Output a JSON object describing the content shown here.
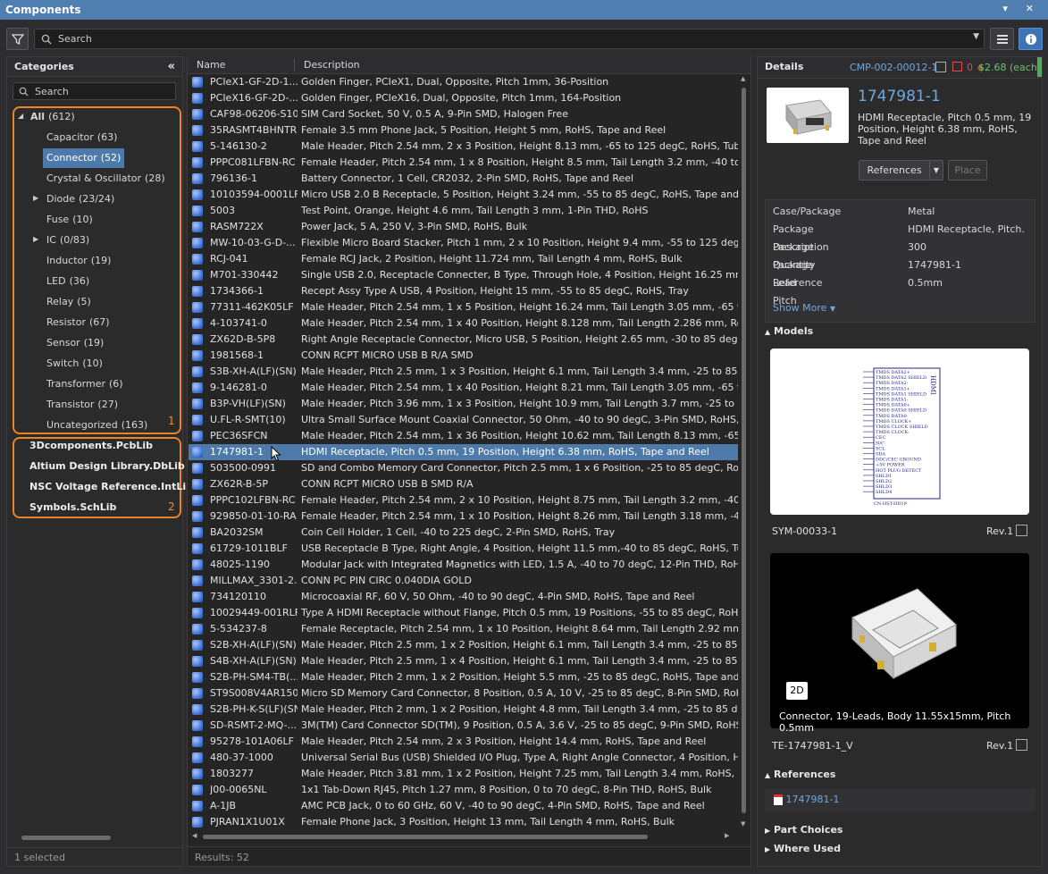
{
  "window": {
    "title": "Components"
  },
  "toolbar": {
    "search_placeholder": "Search"
  },
  "categories": {
    "header": "Categories",
    "search_placeholder": "Search",
    "items": [
      {
        "label": "All",
        "count": "(612)"
      },
      {
        "label": "Capacitor",
        "count": "(63)"
      },
      {
        "label": "Connector",
        "count": "(52)"
      },
      {
        "label": "Crystal & Oscillator",
        "count": "(28)"
      },
      {
        "label": "Diode",
        "count": "(23/24)"
      },
      {
        "label": "Fuse",
        "count": "(10)"
      },
      {
        "label": "IC",
        "count": "(0/83)"
      },
      {
        "label": "Inductor",
        "count": "(19)"
      },
      {
        "label": "LED",
        "count": "(36)"
      },
      {
        "label": "Relay",
        "count": "(5)"
      },
      {
        "label": "Resistor",
        "count": "(67)"
      },
      {
        "label": "Sensor",
        "count": "(19)"
      },
      {
        "label": "Switch",
        "count": "(10)"
      },
      {
        "label": "Transformer",
        "count": "(6)"
      },
      {
        "label": "Transistor",
        "count": "(27)"
      },
      {
        "label": "Uncategorized",
        "count": "(163)"
      }
    ],
    "libraries": [
      "3Dcomponents.PcbLib",
      "Altium Design Library.DbLib",
      "NSC Voltage Reference.IntLib",
      "Symbols.SchLib"
    ],
    "tag1": "1",
    "tag2": "2",
    "status": "1 selected"
  },
  "grid": {
    "col_name": "Name",
    "col_desc": "Description",
    "status": "Results: 52",
    "rows": [
      [
        "PCIeX1-GF-2D-1...",
        "Golden Finger, PCIeX1, Dual, Opposite, Pitch 1mm, 36-Position"
      ],
      [
        "PCIeX16-GF-2D-...",
        "Golden Finger, PCIeX16, Dual, Opposite, Pitch 1mm, 164-Position"
      ],
      [
        "CAF98-06206-S100",
        "SIM Card Socket, 50 V, 0.5 A, 9-Pin SMD, Halogen Free"
      ],
      [
        "35RASMT4BHNTRX",
        "Female 3.5 mm Phone Jack, 5 Position, Height 5 mm, RoHS, Tape and Reel"
      ],
      [
        "5-146130-2",
        "Male Header, Pitch 2.54 mm, 2 x 3 Position, Height 8.13 mm, -65 to 125 degC, RoHS, Tube"
      ],
      [
        "PPPC081LFBN-RC",
        "Female Header, Pitch 2.54 mm, 1 x 8 Position, Height 8.5 mm, Tail Length 3.2 mm, -40 to 105 degC"
      ],
      [
        "796136-1",
        "Battery Connector, 1 Cell, CR2032, 2-Pin SMD, RoHS, Tape and Reel"
      ],
      [
        "10103594-0001LF",
        "Micro USB 2.0 B Receptacle, 5 Position, Height 3.24 mm, -55 to 85 degC, RoHS, Tape and Reel"
      ],
      [
        "5003",
        "Test Point, Orange, Height 4.6 mm, Tail Length 3 mm, 1-Pin THD, RoHS"
      ],
      [
        "RASM722X",
        "Power Jack, 5 A, 250 V, 3-Pin SMD, RoHS, Bulk"
      ],
      [
        "MW-10-03-G-D-...",
        "Flexible Micro Board Stacker, Pitch 1 mm, 2 x 10 Position, Height 9.4 mm, -55 to 125 degC, RoHS,"
      ],
      [
        "RCJ-041",
        "Female RCJ Jack, 2 Position, Height 11.724 mm, Tail Length 4 mm, RoHS, Bulk"
      ],
      [
        "M701-330442",
        "Single USB 2.0, Receptacle Connecter, B Type, Through Hole, 4 Position, Height 16.25 mm, -55 to"
      ],
      [
        "1734366-1",
        "Recept Assy Type A USB, 4 Position, Height 15 mm, -55 to 85 degC, RoHS, Tray"
      ],
      [
        "77311-462K05LF",
        "Male Header, Pitch 2.54 mm, 1 x 5 Position, Height 16.24 mm, Tail Length 3.05 mm, -65 to 125 deg"
      ],
      [
        "4-103741-0",
        "Male Header, Pitch 2.54 mm, 1 x 40 Position, Height 8.128 mm, Tail Length 2.286 mm, RoHS, Bulk"
      ],
      [
        "ZX62D-B-5P8",
        "Right Angle Receptacle Connector, Micro USB, 5 Position, Height 2.65 mm, -30 to 85 degC, RoHS"
      ],
      [
        "1981568-1",
        "CONN RCPT MICRO USB B R/A SMD"
      ],
      [
        "S3B-XH-A(LF)(SN)",
        "Male Header, Pitch 2.5 mm, 1 x 3 Position, Height 6.1 mm, Tail Length 3.4 mm, -25 to 85 degC, Ro"
      ],
      [
        "9-146281-0",
        "Male Header, Pitch 2.54 mm, 1 x 40 Position, Height 8.21 mm, Tail Length 3.05 mm, -65 to 105 deg"
      ],
      [
        "B3P-VH(LF)(SN)",
        "Male Header, Pitch 3.96 mm, 1 x 3 Position, Height 10.9 mm, Tail Length 3.7 mm, -25 to 85 degC, I"
      ],
      [
        "U.FL-R-SMT(10)",
        "Ultra Small Surface Mount Coaxial Connector, 50 Ohm, -40 to 90 degC, 3-Pin SMD, RoHS, Tape a"
      ],
      [
        "PEC36SFCN",
        "Male Header, Pitch 2.54 mm, 1 x 36 Position, Height 10.62 mm, Tail Length 8.13 mm, -65 to 125 de"
      ],
      [
        "1747981-1",
        "HDMI Receptacle, Pitch 0.5 mm, 19 Position, Height 6.38 mm, RoHS, Tape and Reel"
      ],
      [
        "503500-0991",
        "SD and Combo Memory Card Connector, Pitch 2.5 mm, 1 x 6 Position, -25 to 85 degC, RoHS, Tape"
      ],
      [
        "ZX62R-B-5P",
        "CONN RCPT MICRO USB B SMD R/A"
      ],
      [
        "PPPC102LFBN-RC",
        "Female Header, Pitch 2.54 mm, 2 x 10 Position, Height 8.75 mm, Tail Length 3.2 mm, -40 to 105 de"
      ],
      [
        "929850-01-10-RA",
        "Female Header, Pitch 2.54 mm, 1 x 10 Position, Height 8.26 mm, Tail Length 3.18 mm, -40 to 105 d"
      ],
      [
        "BA2032SM",
        "Coin Cell Holder, 1 Cell, -40 to 225 degC, 2-Pin SMD, RoHS, Tray"
      ],
      [
        "61729-1011BLF",
        "USB Receptacle B Type, Right Angle, 4 Position, Height 11.5 mm,-40 to 85 degC, RoHS, Tube"
      ],
      [
        "48025-1190",
        "Modular Jack with Integrated Magnetics with LED, 1.5 A, -40 to 70 degC, 12-Pin THD, RoHS, Tray"
      ],
      [
        "MILLMAX_3301-2...",
        "CONN PC PIN CIRC 0.040DIA GOLD"
      ],
      [
        "734120110",
        "Microcoaxial RF, 60 V, 50 Ohm, -40 to 90 degC, 4-Pin SMD, RoHS, Tape and Reel"
      ],
      [
        "10029449-001RLF",
        "Type A HDMI Receptacle without Flange, Pitch 0.5 mm, 19 Positions, -55 to 85 degC, RoHS, Tape"
      ],
      [
        "5-534237-8",
        "Female Receptacle, Pitch 2.54 mm, 1 x 10 Position, Height 8.64 mm, Tail Length 2.92 mm, -65 to 1("
      ],
      [
        "S2B-XH-A(LF)(SN)",
        "Male Header, Pitch 2.5 mm, 1 x 2 Position, Height 6.1 mm, Tail Length 3.4 mm, -25 to 85 degC, Ro"
      ],
      [
        "S4B-XH-A(LF)(SN)",
        "Male Header, Pitch 2.5 mm, 1 x 4 Position, Height 6.1 mm, Tail Length 3.4 mm, -25 to 85 degC, Ro"
      ],
      [
        "S2B-PH-SM4-TB(...",
        "Male Header, Pitch 2 mm, 1 x 2 Position, Height 5.5 mm, -25 to 85 degC, RoHS, Tape and Reel"
      ],
      [
        "ST9S008V4AR1500",
        "Micro SD Memory Card Connector, 8 Position, 0.5 A, 10 V, -25 to 85 degC, 8-Pin SMD, RoHS, Tape"
      ],
      [
        "S2B-PH-K-S(LF)(SN)",
        "Male Header, Pitch 2 mm, 1 x 2 Position, Height 4.8 mm, Tail Length 3.4 mm, -25 to 85 degC, RoH"
      ],
      [
        "SD-RSMT-2-MQ-...",
        "3M(TM) Card Connector SD(TM), 9 Position, 0.5 A, 3.6 V, -25 to 85 degC, 9-Pin SMD, RoHS, Tape a"
      ],
      [
        "95278-101A06LF",
        "Male Header, Pitch 2.54 mm, 2 x 3 Position, Height 14.4 mm, RoHS, Tape and Reel"
      ],
      [
        "480-37-1000",
        "Universal Serial Bus (USB) Shielded I/O Plug, Type A, Right Angle Connector, 4 Position, Height 4"
      ],
      [
        "1803277",
        "Male Header, Pitch 3.81 mm, 1 x 2 Position, Height 7.25 mm, Tail Length 3.4 mm, RoHS, Bulk"
      ],
      [
        "J00-0065NL",
        "1x1 Tab-Down RJ45, Pitch 1.27 mm, 8 Position, 0 to 70 degC, 8-Pin THD, RoHS, Bulk"
      ],
      [
        "A-1JB",
        "AMC PCB Jack, 0 to 60 GHz, 60 V, -40 to 90 degC, 4-Pin SMD, RoHS, Tape and Reel"
      ],
      [
        "PJRAN1X1U01X",
        "Female Phone Jack, 3 Position, Height 13 mm, Tail Length 4 mm, RoHS, Bulk"
      ]
    ]
  },
  "details": {
    "header": "Details",
    "id": "CMP-002-00012-1",
    "count": "0",
    "price": "$2.68 (each)",
    "part_name": "1747981-1",
    "part_desc": "HDMI Receptacle, Pitch 0.5 mm, 19 Position, Height 6.38 mm, RoHS, Tape and Reel",
    "btn_references": "References",
    "btn_place": "Place",
    "props": [
      [
        "Case/Package",
        "Metal"
      ],
      [
        "Package Description",
        "HDMI Receptacle, Pitch..."
      ],
      [
        "Package Quantity",
        "300"
      ],
      [
        "Package Reference",
        "1747981-1"
      ],
      [
        "Lead Pitch",
        "0.5mm"
      ]
    ],
    "show_more": "Show More",
    "models_header": "Models",
    "sym_name": "SYM-00033-1",
    "sym_rev": "Rev.1",
    "sym_pins": [
      "TMDS DATA2+",
      "TMDS DATA2 SHIELD",
      "TMDS DATA2-",
      "TMDS DATA1+",
      "TMDS DATA1 SHIELD",
      "TMDS DATA1-",
      "TMDS DATA0+",
      "TMDS DATA0 SHIELD",
      "TMDS DATA0-",
      "TMDS CLOCK+",
      "TMDS CLOCK SHIELD",
      "TMDS CLOCK-",
      "CEC",
      "N/C",
      "SCL",
      "SDA",
      "DDC/CEC GROUND",
      "+5V POWER",
      "HOT PLUG DETECT",
      "SHLD1",
      "SHLD2",
      "SHLD3",
      "SHLD4"
    ],
    "sym_title": "HDMI",
    "sym_footer": "CN-HST-HD19",
    "model3d_badge": "2D",
    "model3d_caption": "Connector, 19-Leads, Body 11.55x15mm, Pitch 0.5mm",
    "model3d_name": "TE-1747981-1_V",
    "model3d_rev": "Rev.1",
    "references_header": "References",
    "reference_link": "1747981-1",
    "part_choices": "Part Choices",
    "where_used": "Where Used"
  }
}
